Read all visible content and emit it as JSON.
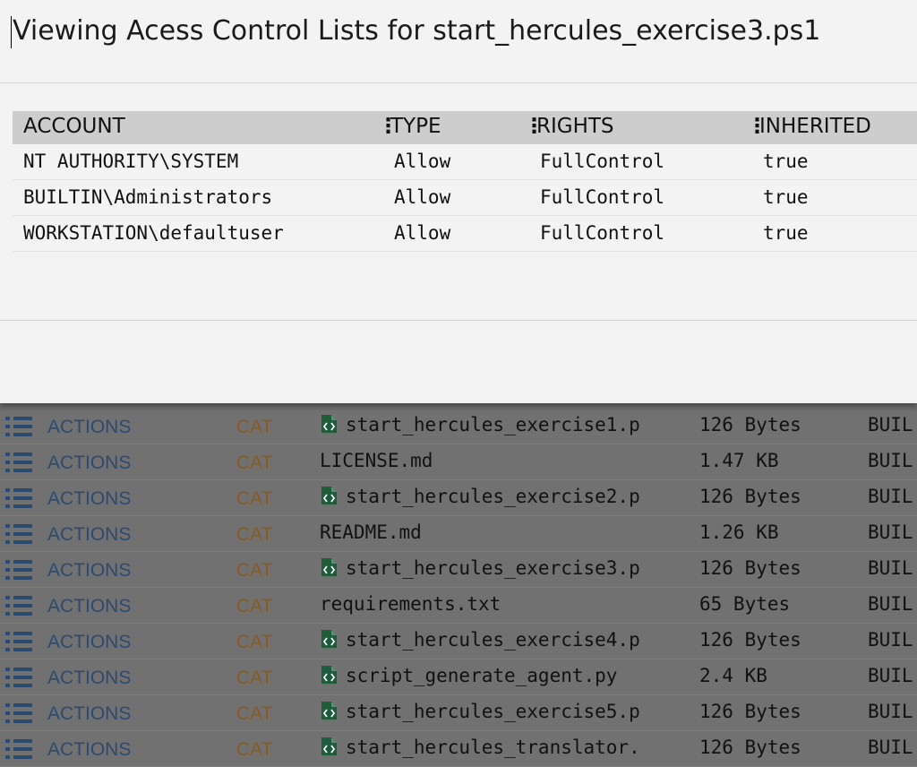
{
  "modal": {
    "title": "Viewing Acess Control Lists for start_hercules_exercise3.ps1",
    "columns": [
      "ACCOUNT",
      "TYPE",
      "RIGHTS",
      "INHERITED"
    ],
    "rows": [
      {
        "account": "NT AUTHORITY\\SYSTEM",
        "type": "Allow",
        "rights": "FullControl",
        "inherited": "true"
      },
      {
        "account": "BUILTIN\\Administrators",
        "type": "Allow",
        "rights": "FullControl",
        "inherited": "true"
      },
      {
        "account": "WORKSTATION\\defaultuser",
        "type": "Allow",
        "rights": "FullControl",
        "inherited": "true"
      }
    ]
  },
  "file_list": {
    "action_label": "ACTIONS",
    "cat_label": "CAT",
    "colors": {
      "action": "#2c4a70",
      "cat": "#8a5a20",
      "file_icon": "#1e5c3c"
    },
    "rows": [
      {
        "name": "start_hercules_exercise1.p",
        "size": "126 Bytes",
        "owner": "BUIL",
        "icon": "script-file-icon"
      },
      {
        "name": "LICENSE.md",
        "size": "1.47 KB",
        "owner": "BUIL",
        "icon": ""
      },
      {
        "name": "start_hercules_exercise2.p",
        "size": "126 Bytes",
        "owner": "BUIL",
        "icon": "script-file-icon"
      },
      {
        "name": "README.md",
        "size": "1.26 KB",
        "owner": "BUIL",
        "icon": ""
      },
      {
        "name": "start_hercules_exercise3.p",
        "size": "126 Bytes",
        "owner": "BUIL",
        "icon": "script-file-icon"
      },
      {
        "name": "requirements.txt",
        "size": "65 Bytes",
        "owner": "BUIL",
        "icon": ""
      },
      {
        "name": "start_hercules_exercise4.p",
        "size": "126 Bytes",
        "owner": "BUIL",
        "icon": "script-file-icon"
      },
      {
        "name": "script_generate_agent.py",
        "size": "2.4 KB",
        "owner": "BUIL",
        "icon": "script-file-icon"
      },
      {
        "name": "start_hercules_exercise5.p",
        "size": "126 Bytes",
        "owner": "BUIL",
        "icon": "script-file-icon"
      },
      {
        "name": "start_hercules_translator.",
        "size": "126 Bytes",
        "owner": "BUIL",
        "icon": "script-file-icon"
      }
    ]
  }
}
